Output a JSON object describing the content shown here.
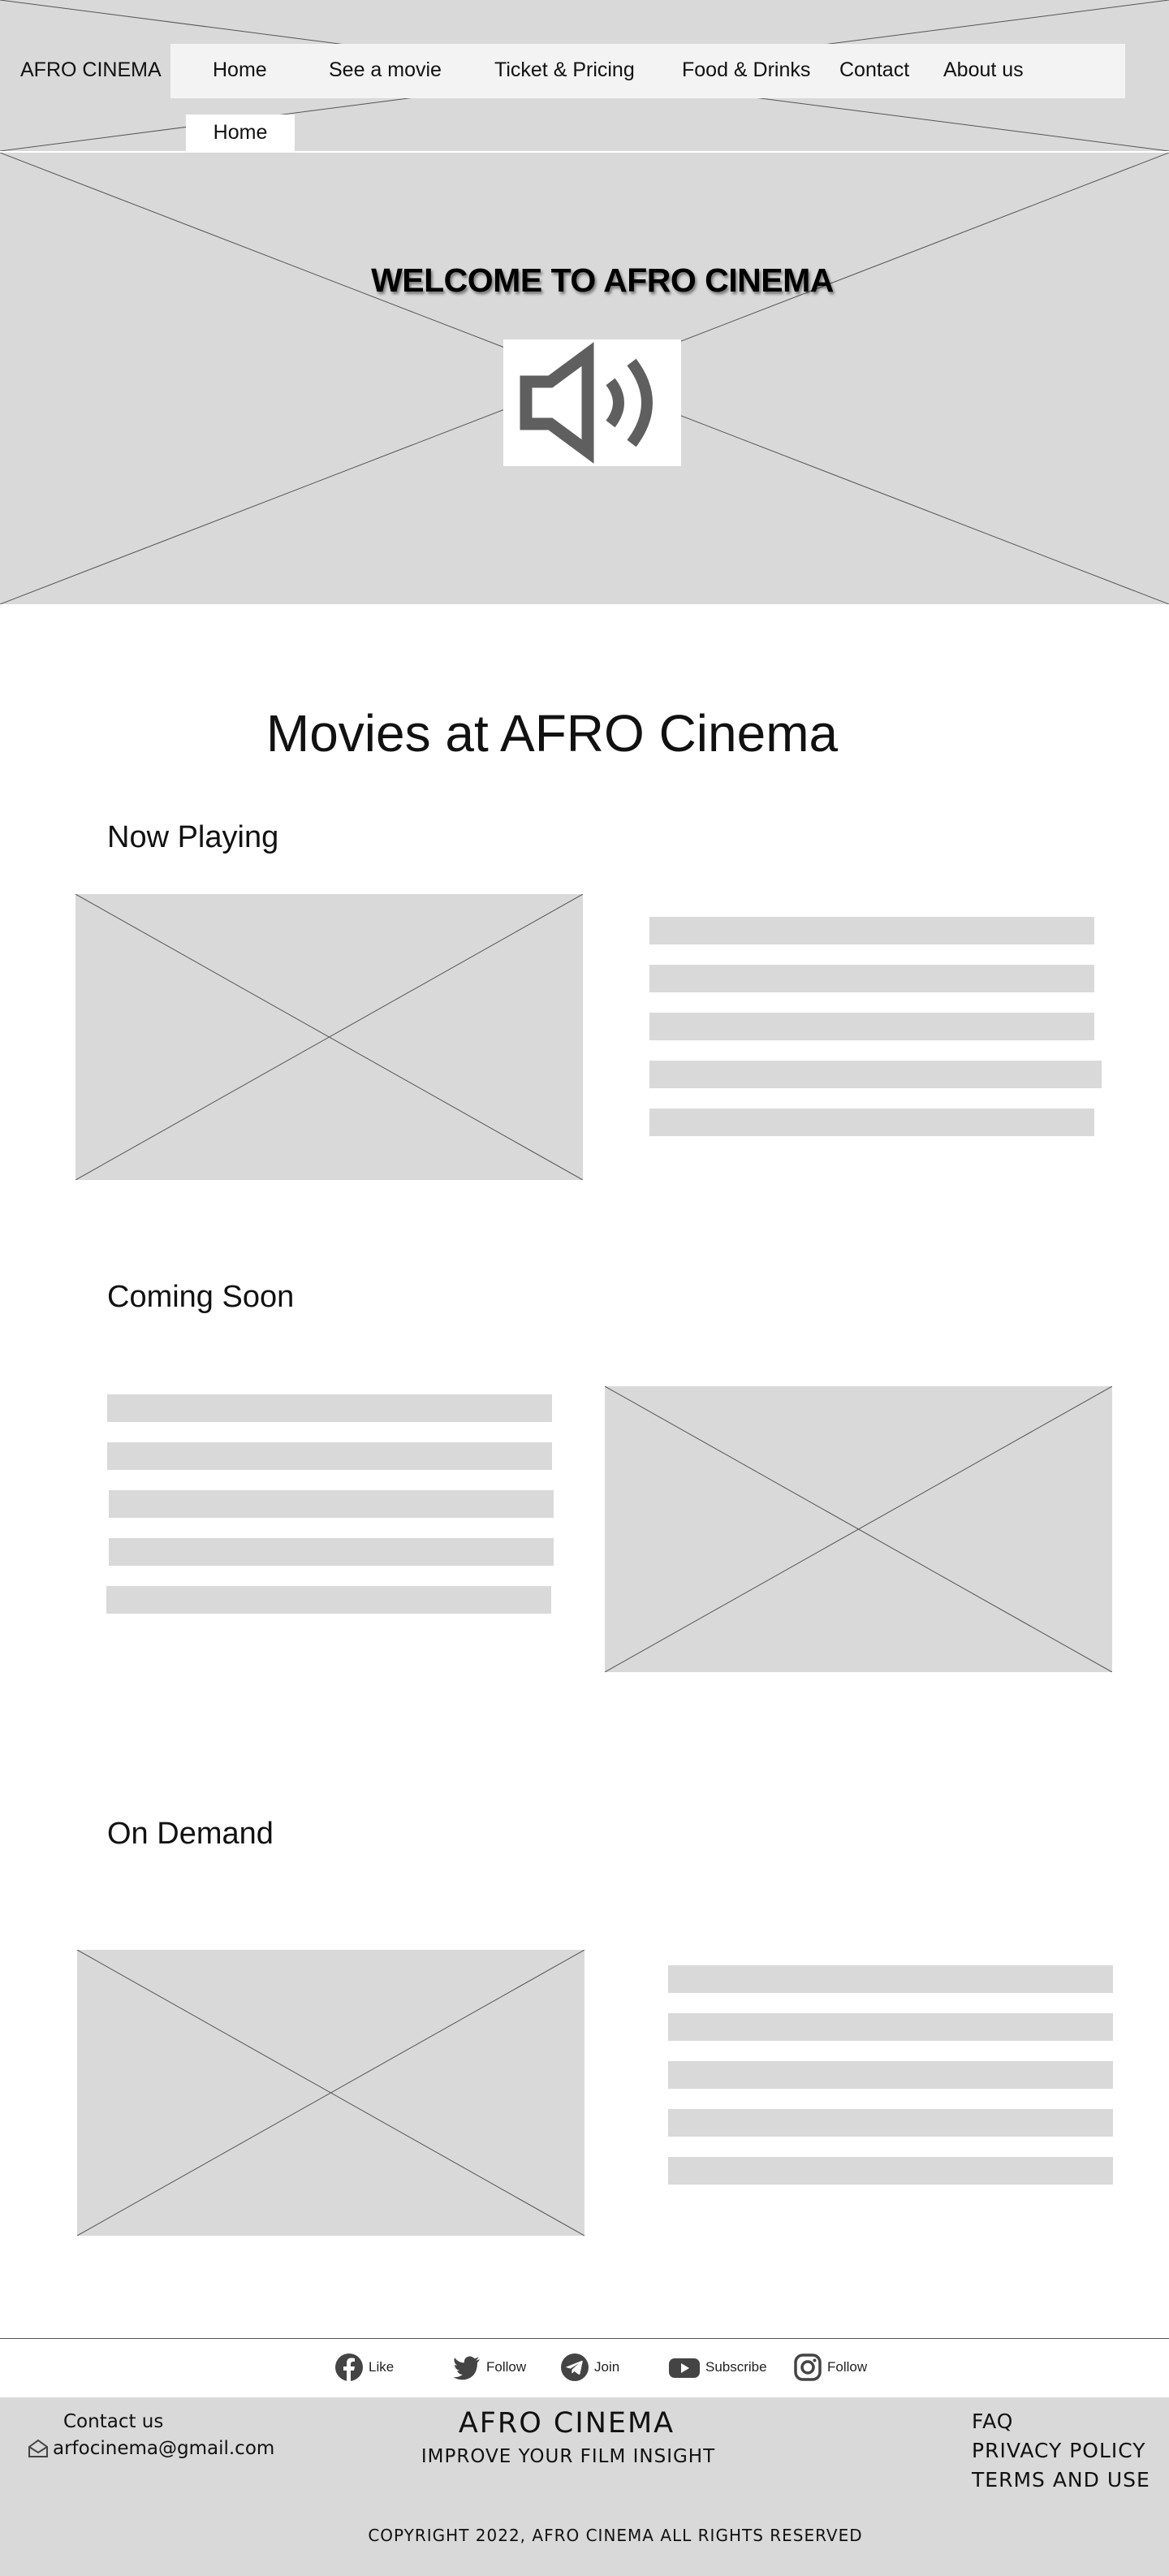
{
  "header": {
    "brand": "AFRO CINEMA",
    "nav": [
      "Home",
      "See a movie",
      "Ticket & Pricing",
      "Food & Drinks",
      "Contact",
      "About us"
    ],
    "active_tab": "Home"
  },
  "hero": {
    "title": "WELCOME TO AFRO CINEMA",
    "audio_icon": "speaker-icon"
  },
  "main": {
    "title": "Movies at AFRO Cinema",
    "sections": [
      {
        "title": "Now Playing"
      },
      {
        "title": "Coming Soon"
      },
      {
        "title": "On Demand"
      }
    ]
  },
  "social": [
    {
      "icon": "facebook-icon",
      "label": "Like"
    },
    {
      "icon": "twitter-icon",
      "label": "Follow"
    },
    {
      "icon": "telegram-icon",
      "label": "Join"
    },
    {
      "icon": "youtube-icon",
      "label": "Subscribe"
    },
    {
      "icon": "instagram-icon",
      "label": "Follow"
    }
  ],
  "footer": {
    "contact_title": "Contact us",
    "email": "arfocinema@gmail.com",
    "brand": "AFRO CINEMA",
    "tagline": "IMPROVE YOUR FILM INSIGHT",
    "links": [
      "FAQ",
      "PRIVACY POLICY",
      "TERMS AND USE"
    ],
    "copyright": "COPYRIGHT 2022, AFRO CINEMA ALL RIGHTS RESERVED"
  },
  "colors": {
    "placeholder": "#d9d9d9",
    "nav_bar": "#f3f3f3",
    "icon": "#444444"
  }
}
